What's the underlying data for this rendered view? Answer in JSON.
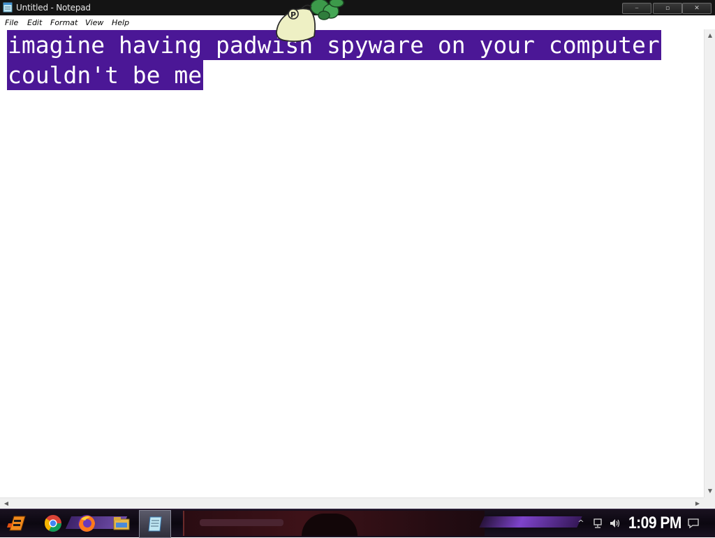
{
  "window": {
    "title": "Untitled - Notepad",
    "minimize_label": "⎯",
    "maximize_label": "▫",
    "close_label": "✕"
  },
  "mascot": {
    "badge_letter": "P",
    "icon": "padwish-mascot-icon"
  },
  "menu": {
    "items": [
      {
        "label": "File"
      },
      {
        "label": "Edit"
      },
      {
        "label": "Format"
      },
      {
        "label": "View"
      },
      {
        "label": "Help"
      }
    ]
  },
  "editor": {
    "lines": [
      "imagine having padwish spyware on your computer",
      "couldn't be me"
    ],
    "selection_color": "#4b1796",
    "all_text_selected": true
  },
  "taskbar": {
    "pinned": [
      {
        "name": "start-icon"
      },
      {
        "name": "chrome-icon"
      },
      {
        "name": "firefox-icon"
      },
      {
        "name": "file-explorer-icon"
      },
      {
        "name": "notepad-icon",
        "active": true
      }
    ],
    "tray": {
      "show_hidden": "^",
      "clock": "1:09 PM"
    }
  },
  "colors": {
    "titlebar": "#141414",
    "taskbar_accent": "#8a4ae0"
  }
}
